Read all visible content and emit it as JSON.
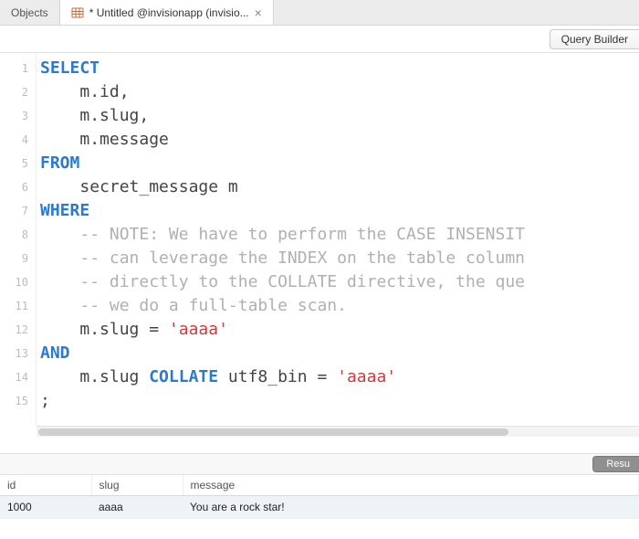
{
  "tabs": {
    "objects": "Objects",
    "active": "* Untitled @invisionapp (invisio..."
  },
  "toolbar": {
    "query_builder": "Query Builder"
  },
  "editor": {
    "lines": {
      "select": "SELECT",
      "id": "m.id,",
      "slug": "m.slug,",
      "message": "m.message",
      "from": "FROM",
      "table": "secret_message m",
      "where": "WHERE",
      "c1": "-- NOTE: We have to perform the CASE INSENSIT",
      "c2": "-- can leverage the INDEX on the table column",
      "c3": "-- directly to the COLLATE directive, the que",
      "c4": "-- we do a full-table scan.",
      "p1a": "m.slug = ",
      "p1b": "'aaaa'",
      "and": "AND",
      "p2a": "m.slug ",
      "p2b": "COLLATE",
      "p2c": " utf8_bin = ",
      "p2d": "'aaaa'",
      "semi": ";"
    }
  },
  "results": {
    "button": "Resu",
    "headers": {
      "id": "id",
      "slug": "slug",
      "message": "message"
    },
    "rows": [
      {
        "id": "1000",
        "slug": "aaaa",
        "message": "You are a rock star!"
      }
    ]
  }
}
